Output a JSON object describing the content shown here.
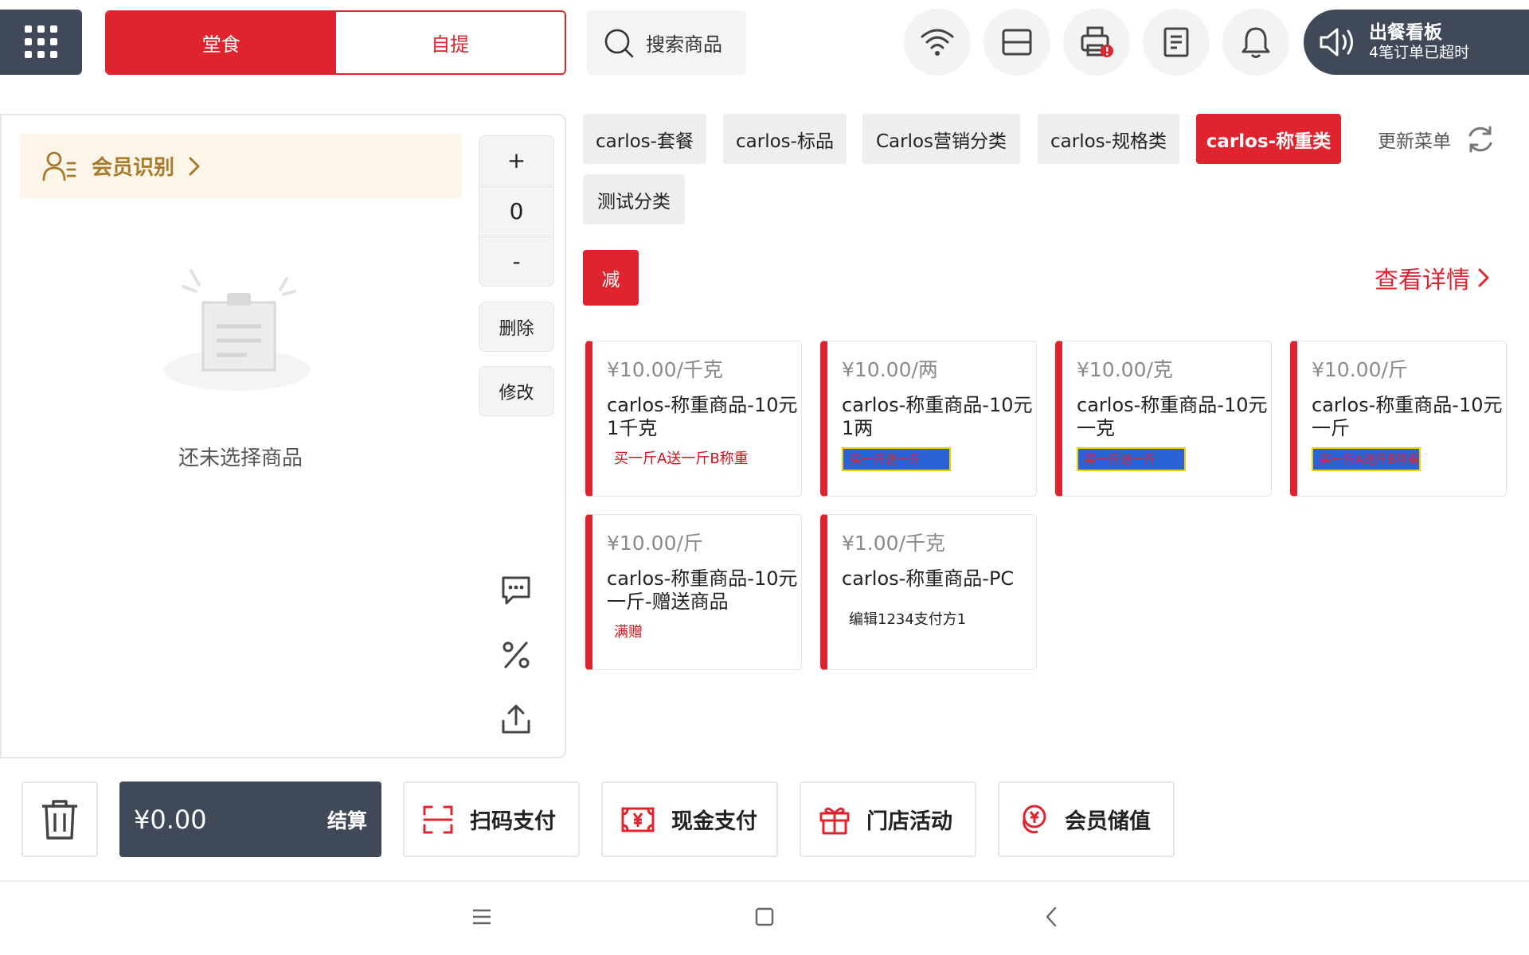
{
  "topbar": {
    "order_tabs": [
      {
        "label": "堂食",
        "active": true
      },
      {
        "label": "自提",
        "active": false
      }
    ],
    "search_label": "搜索商品",
    "kds_board": {
      "title": "出餐看板",
      "subtitle": "4笔订单已超时"
    }
  },
  "cart": {
    "member_label": "会员识别",
    "qty_plus": "+",
    "qty_value": "0",
    "qty_minus": "-",
    "delete_label": "删除",
    "modify_label": "修改",
    "empty_text": "还未选择商品"
  },
  "categories": [
    {
      "label": "carlos-套餐",
      "active": false
    },
    {
      "label": "carlos-标品",
      "active": false
    },
    {
      "label": "Carlos营销分类",
      "active": false
    },
    {
      "label": "carlos-规格类",
      "active": false
    },
    {
      "label": "carlos-称重类",
      "active": true
    },
    {
      "label": "测试分类",
      "active": false
    }
  ],
  "refresh_label": "更新菜单",
  "promo_tag": "减",
  "detail_link": "查看详情",
  "products": [
    {
      "price": "¥10.00/千克",
      "name": "carlos-称重商品-10元1千克",
      "tag": "买一斤A送一斤B称重",
      "tag_style": "red"
    },
    {
      "price": "¥10.00/两",
      "name": "carlos-称重商品-10元1两",
      "tag": "买一斤送一斤",
      "tag_style": "blue"
    },
    {
      "price": "¥10.00/克",
      "name": "carlos-称重商品-10元一克",
      "tag": "买一斤送一斤",
      "tag_style": "blue"
    },
    {
      "price": "¥10.00/斤",
      "name": "carlos-称重商品-10元一斤",
      "tag": "买一斤A送斤B称重",
      "tag_style": "blue"
    },
    {
      "price": "¥10.00/斤",
      "name": "carlos-称重商品-10元一斤-赠送商品",
      "tag": "满赠",
      "tag_style": "red"
    },
    {
      "price": "¥1.00/千克",
      "name": "carlos-称重商品-PC",
      "tag": "编辑1234支付方1",
      "tag_style": "black"
    }
  ],
  "footer": {
    "total": "¥0.00",
    "checkout_label": "结算",
    "scan_pay": "扫码支付",
    "cash_pay": "现金支付",
    "store_activity": "门店活动",
    "member_recharge": "会员储值"
  },
  "colors": {
    "accent": "#e0242f",
    "dark": "#3f4958",
    "member_bg": "#fbf6e7",
    "member_text": "#a77b2b"
  }
}
